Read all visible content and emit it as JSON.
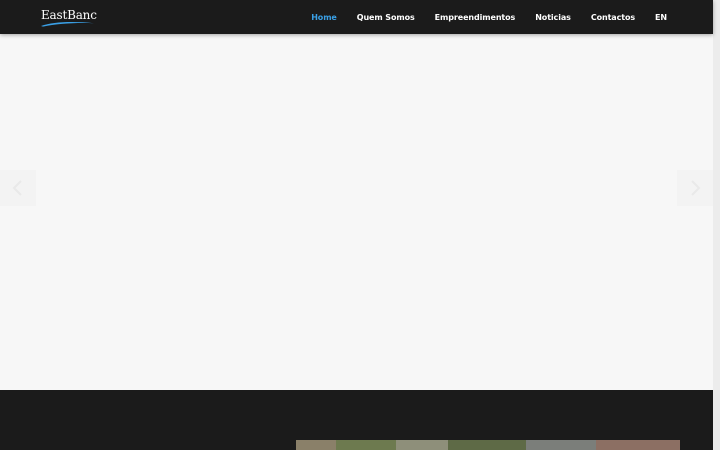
{
  "brand": {
    "logo_text": "EastBanc"
  },
  "nav": {
    "items": [
      {
        "label": "Home",
        "active": true
      },
      {
        "label": "Quem Somos",
        "active": false
      },
      {
        "label": "Empreendimentos",
        "active": false
      },
      {
        "label": "Noticias",
        "active": false
      },
      {
        "label": "Contactos",
        "active": false
      },
      {
        "label": "EN",
        "active": false
      }
    ]
  },
  "slider": {
    "prev_icon": "chevron-left-icon",
    "next_icon": "chevron-right-icon"
  },
  "colors": {
    "navbar_bg": "#1b1b1b",
    "accent": "#3aa0e6",
    "page_bg": "#f7f7f7",
    "band_bg": "#1b1b1b"
  }
}
